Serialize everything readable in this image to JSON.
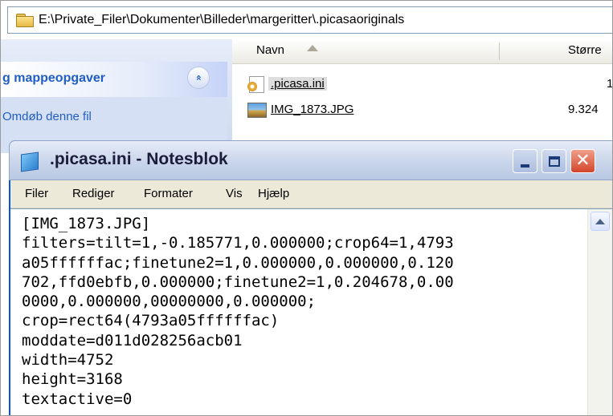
{
  "explorer": {
    "address_path": "E:\\Private_Filer\\Dokumenter\\Billeder\\margeritter\\.picasaoriginals",
    "taskpane": {
      "header": "g mappeopgaver",
      "collapse_glyph": "»",
      "task": "Omdøb denne fil"
    },
    "columns": {
      "name": "Navn",
      "size": "Større"
    },
    "files": [
      {
        "name": ".picasa.ini",
        "size": "1",
        "icon": "ini-settings-icon"
      },
      {
        "name": "IMG_1873.JPG",
        "size": "9.324",
        "icon": "jpeg-image-icon"
      }
    ]
  },
  "notepad": {
    "title": ".picasa.ini - Notesblok",
    "menu": [
      "Filer",
      "Rediger",
      "Formater",
      "Vis",
      "Hjælp"
    ],
    "close_glyph": "✕",
    "content": "[IMG_1873.JPG]\nfilters=tilt=1,-0.185771,0.000000;crop64=1,4793\na05ffffffac;finetune2=1,0.000000,0.000000,0.120\n702,ffd0ebfb,0.000000;finetune2=1,0.204678,0.00\n0000,0.000000,00000000,0.000000;\ncrop=rect64(4793a05ffffffac)\nmoddate=d011d028256acb01\nwidth=4752\nheight=3168\ntextactive=0"
  },
  "colors": {
    "link_blue": "#215dc6",
    "close_red": "#d2452b",
    "menubar_bg": "#ece9d8"
  }
}
